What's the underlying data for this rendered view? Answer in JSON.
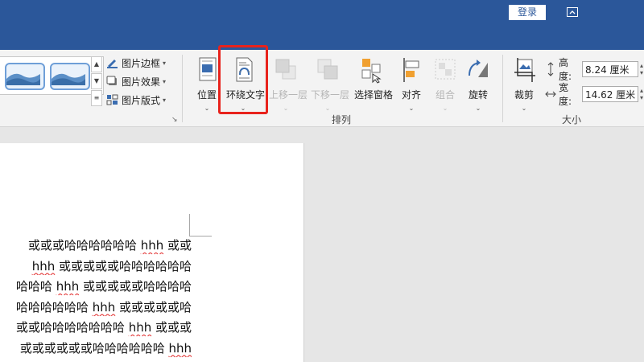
{
  "titlebar": {
    "login_label": "登录"
  },
  "ribbon": {
    "picture_commands": [
      {
        "label": "图片边框",
        "icon": "picture-border-icon"
      },
      {
        "label": "图片效果",
        "icon": "picture-effects-icon"
      },
      {
        "label": "图片版式",
        "icon": "picture-layout-icon"
      }
    ],
    "arrange": {
      "group_label": "排列",
      "buttons": [
        {
          "label": "位置",
          "icon": "position-icon",
          "enabled": true
        },
        {
          "label": "环绕文字",
          "icon": "wrap-text-icon",
          "enabled": true
        },
        {
          "label": "上移一层",
          "icon": "bring-forward-icon",
          "enabled": false
        },
        {
          "label": "下移一层",
          "icon": "send-backward-icon",
          "enabled": false
        },
        {
          "label": "选择窗格",
          "icon": "selection-pane-icon",
          "enabled": true
        },
        {
          "label": "对齐",
          "icon": "align-icon",
          "enabled": true
        },
        {
          "label": "组合",
          "icon": "group-icon",
          "enabled": false
        },
        {
          "label": "旋转",
          "icon": "rotate-icon",
          "enabled": true
        }
      ]
    },
    "size": {
      "group_label": "大小",
      "crop_label": "裁剪",
      "height_label": "高度:",
      "height_value": "8.24 厘米",
      "width_label": "宽度:",
      "width_value": "14.62 厘米"
    },
    "colors": {
      "titlebar": "#2b579a",
      "highlight": "#e8221c"
    }
  },
  "document": {
    "lines": [
      {
        "pre": "或或或哈哈哈哈哈哈 ",
        "wavy": "hhh",
        "post": " 或或"
      },
      {
        "pre": "",
        "wavy": "hhh",
        "post": " 或或或或或哈哈哈哈哈哈"
      },
      {
        "pre": "哈哈哈 ",
        "wavy": "hhh",
        "post": " 或或或或或哈哈哈哈"
      },
      {
        "pre": "哈哈哈哈哈哈 ",
        "wavy": "hhh",
        "post": " 或或或或或哈"
      },
      {
        "pre": "或或哈哈哈哈哈哈哈 ",
        "wavy": "hhh",
        "post": " 或或或"
      },
      {
        "pre": "或或或或或或哈哈哈哈哈哈 ",
        "wavy": "hhh",
        "post": ""
      }
    ]
  }
}
